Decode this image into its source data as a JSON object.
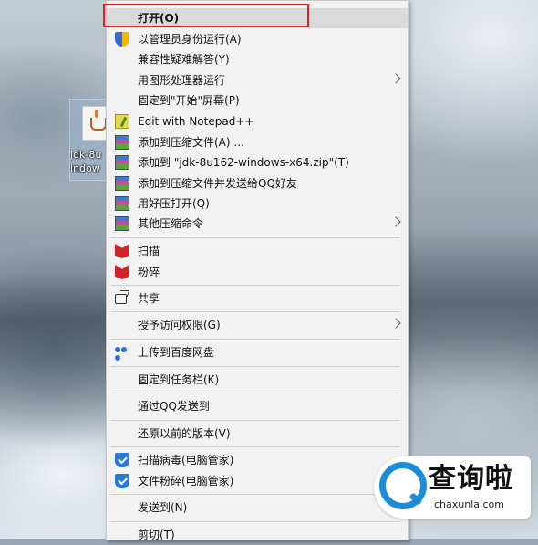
{
  "desktop_icon": {
    "label_line1": "jdk-8u",
    "label_line2": "indow"
  },
  "context_menu": {
    "items": [
      {
        "label": "打开(O)",
        "icon": "",
        "submenu": false
      },
      {
        "label": "以管理员身份运行(A)",
        "icon": "uac-shield-icon",
        "submenu": false
      },
      {
        "label": "兼容性疑难解答(Y)",
        "icon": "",
        "submenu": false
      },
      {
        "label": "用图形处理器运行",
        "icon": "",
        "submenu": true
      },
      {
        "label": "固定到\"开始\"屏幕(P)",
        "icon": "",
        "submenu": false
      },
      {
        "label": "Edit with Notepad++",
        "icon": "notepad-plus-plus-icon",
        "submenu": false
      },
      {
        "label": "添加到压缩文件(A) ...",
        "icon": "winrar-archive-icon",
        "submenu": false
      },
      {
        "label": "添加到 \"jdk-8u162-windows-x64.zip\"(T)",
        "icon": "winrar-archive-icon",
        "submenu": false
      },
      {
        "label": "添加到压缩文件并发送给QQ好友",
        "icon": "winrar-archive-icon",
        "submenu": false
      },
      {
        "label": "用好压打开(Q)",
        "icon": "winrar-archive-icon",
        "submenu": false
      },
      {
        "label": "其他压缩命令",
        "icon": "winrar-archive-icon",
        "submenu": true
      },
      {
        "label": "扫描",
        "icon": "mcafee-icon",
        "submenu": false
      },
      {
        "label": "粉碎",
        "icon": "mcafee-icon",
        "submenu": false
      },
      {
        "label": "共享",
        "icon": "share-icon",
        "submenu": false
      },
      {
        "label": "授予访问权限(G)",
        "icon": "",
        "submenu": true
      },
      {
        "label": "上传到百度网盘",
        "icon": "baidu-netdisk-icon",
        "submenu": false
      },
      {
        "label": "固定到任务栏(K)",
        "icon": "",
        "submenu": false
      },
      {
        "label": "通过QQ发送到",
        "icon": "",
        "submenu": false
      },
      {
        "label": "还原以前的版本(V)",
        "icon": "",
        "submenu": false
      },
      {
        "label": "扫描病毒(电脑管家)",
        "icon": "pc-manager-shield-icon",
        "submenu": false
      },
      {
        "label": "文件粉碎(电脑管家)",
        "icon": "pc-manager-shield-icon",
        "submenu": false
      },
      {
        "label": "发送到(N)",
        "icon": "",
        "submenu": true
      },
      {
        "label": "剪切(T)",
        "icon": "",
        "submenu": false
      }
    ]
  },
  "watermark": {
    "text": "查询啦",
    "url": "chaxunla.com"
  },
  "colors": {
    "highlight_box": "#d9231f",
    "menu_background": "#f2f2f2",
    "watermark_blue": "#1a8cd8"
  }
}
